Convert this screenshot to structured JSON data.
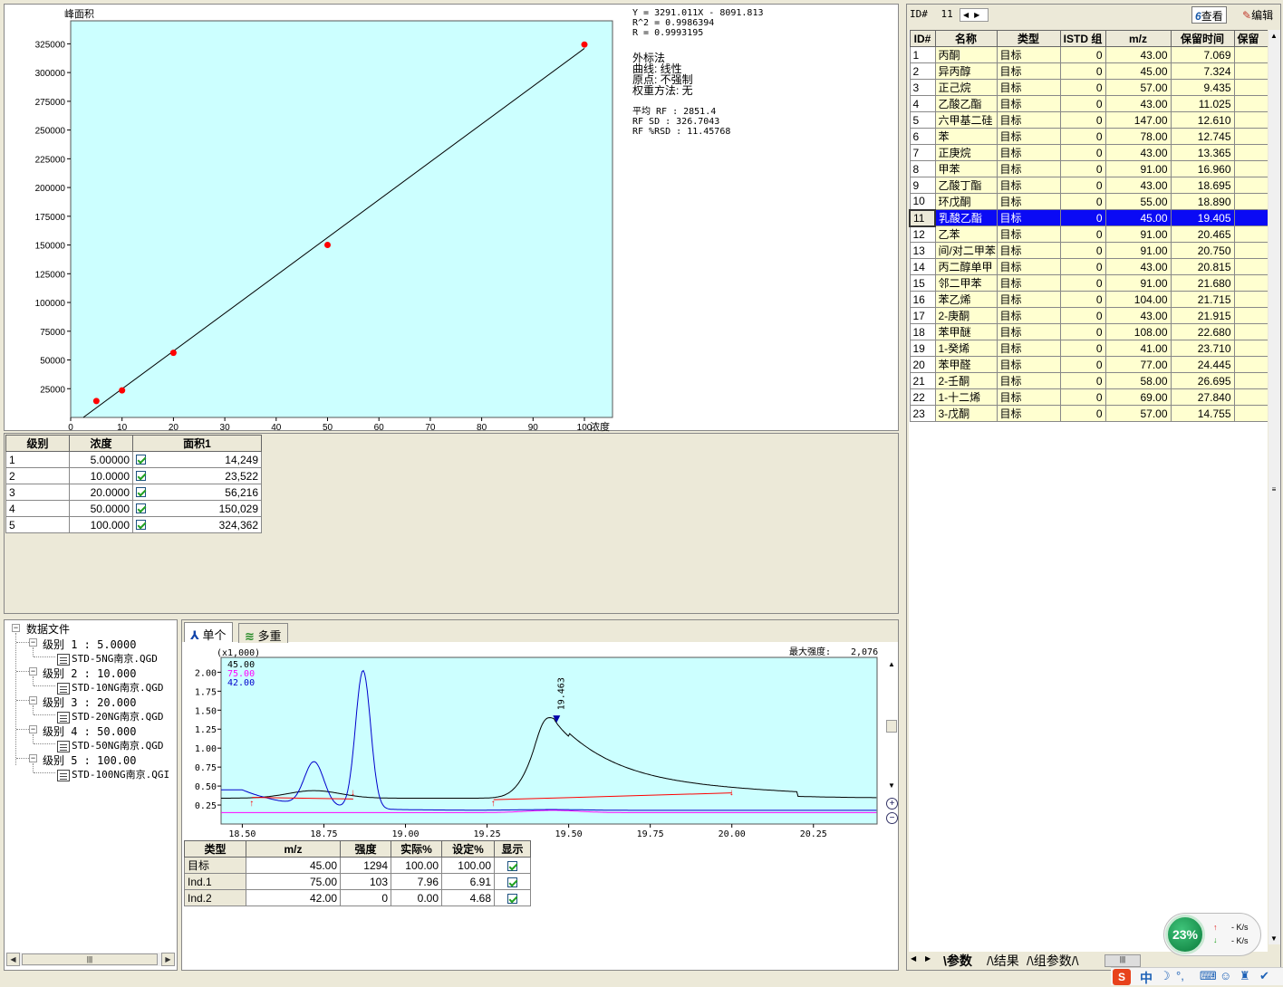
{
  "calib": {
    "y_title": "峰面积",
    "x_title": "浓度",
    "y_ticks": [
      "25000",
      "50000",
      "75000",
      "100000",
      "125000",
      "150000",
      "175000",
      "200000",
      "225000",
      "250000",
      "275000",
      "300000",
      "325000"
    ],
    "x_ticks": [
      "0",
      "10",
      "20",
      "30",
      "40",
      "50",
      "60",
      "70",
      "80",
      "90",
      "100"
    ],
    "equation": "Y = 3291.011X - 8091.813",
    "r2": "R^2 = 0.9986394",
    "r": "R = 0.9993195",
    "method": "外标法",
    "curve": "曲线: 线性",
    "origin": "原点: 不强制",
    "weight": "权重方法: 无",
    "avg_rf": "平均 RF :  2851.4",
    "rf_sd": "RF SD : 326.7043",
    "rf_rsd": "RF %RSD : 11.45768",
    "points": [
      [
        5,
        14249
      ],
      [
        10,
        23522
      ],
      [
        20,
        56216
      ],
      [
        50,
        150029
      ],
      [
        100,
        324362
      ]
    ]
  },
  "level_table": {
    "headers": [
      "级别",
      "浓度",
      "面积1"
    ],
    "rows": [
      [
        "1",
        "5.00000",
        "14,249"
      ],
      [
        "2",
        "10.0000",
        "23,522"
      ],
      [
        "3",
        "20.0000",
        "56,216"
      ],
      [
        "4",
        "50.0000",
        "150,029"
      ],
      [
        "5",
        "100.000",
        "324,362"
      ]
    ]
  },
  "tree": {
    "root": "数据文件",
    "levels": [
      {
        "label": "级别 1 : 5.0000",
        "file": "STD-5NG南京.QGD"
      },
      {
        "label": "级别 2 : 10.000",
        "file": "STD-10NG南京.QGD"
      },
      {
        "label": "级别 3 : 20.000",
        "file": "STD-20NG南京.QGD"
      },
      {
        "label": "级别 4 : 50.000",
        "file": "STD-50NG南京.QGD"
      },
      {
        "label": "级别 5 : 100.00",
        "file": "STD-100NG南京.QGI"
      }
    ]
  },
  "chrom": {
    "tab_single": "单个",
    "tab_multi": "多重",
    "scale": "(x1,000)",
    "max_label": "最大强度:",
    "max_value": "2,076",
    "legend": [
      "45.00",
      "75.00",
      "42.00"
    ],
    "peak_label": "19.463",
    "y_ticks": [
      "0.25",
      "0.50",
      "0.75",
      "1.00",
      "1.25",
      "1.50",
      "1.75",
      "2.00"
    ],
    "x_ticks": [
      "18.50",
      "18.75",
      "19.00",
      "19.25",
      "19.50",
      "19.75",
      "20.00",
      "20.25"
    ]
  },
  "ion_table": {
    "headers": [
      "类型",
      "m/z",
      "强度",
      "实际%",
      "设定%",
      "显示"
    ],
    "rows": [
      [
        "目标",
        "45.00",
        "1294",
        "100.00",
        "100.00"
      ],
      [
        "Ind.1",
        "75.00",
        "103",
        "7.96",
        "6.91"
      ],
      [
        "Ind.2",
        "42.00",
        "0",
        "0.00",
        "4.68"
      ]
    ]
  },
  "compound": {
    "id_label": "ID#",
    "id_value": "11",
    "view_btn": "查看",
    "edit_btn": "编辑",
    "headers": [
      "ID#",
      "名称",
      "类型",
      "ISTD 组",
      "m/z",
      "保留时间",
      "保留"
    ],
    "selected_index": 10,
    "rows": [
      [
        "1",
        "丙酮",
        "目标",
        "0",
        "43.00",
        "7.069"
      ],
      [
        "2",
        "异丙醇",
        "目标",
        "0",
        "45.00",
        "7.324"
      ],
      [
        "3",
        "正己烷",
        "目标",
        "0",
        "57.00",
        "9.435"
      ],
      [
        "4",
        "乙酸乙酯",
        "目标",
        "0",
        "43.00",
        "11.025"
      ],
      [
        "5",
        "六甲基二硅",
        "目标",
        "0",
        "147.00",
        "12.610"
      ],
      [
        "6",
        "苯",
        "目标",
        "0",
        "78.00",
        "12.745"
      ],
      [
        "7",
        "正庚烷",
        "目标",
        "0",
        "43.00",
        "13.365"
      ],
      [
        "8",
        "甲苯",
        "目标",
        "0",
        "91.00",
        "16.960"
      ],
      [
        "9",
        "乙酸丁酯",
        "目标",
        "0",
        "43.00",
        "18.695"
      ],
      [
        "10",
        "环戊酮",
        "目标",
        "0",
        "55.00",
        "18.890"
      ],
      [
        "11",
        "乳酸乙酯",
        "目标",
        "0",
        "45.00",
        "19.405"
      ],
      [
        "12",
        "乙苯",
        "目标",
        "0",
        "91.00",
        "20.465"
      ],
      [
        "13",
        "间/对二甲苯",
        "目标",
        "0",
        "91.00",
        "20.750"
      ],
      [
        "14",
        "丙二醇单甲",
        "目标",
        "0",
        "43.00",
        "20.815"
      ],
      [
        "15",
        "邻二甲苯",
        "目标",
        "0",
        "91.00",
        "21.680"
      ],
      [
        "16",
        "苯乙烯",
        "目标",
        "0",
        "104.00",
        "21.715"
      ],
      [
        "17",
        "2-庚酮",
        "目标",
        "0",
        "43.00",
        "21.915"
      ],
      [
        "18",
        "苯甲醚",
        "目标",
        "0",
        "108.00",
        "22.680"
      ],
      [
        "19",
        "1-癸烯",
        "目标",
        "0",
        "41.00",
        "23.710"
      ],
      [
        "20",
        "苯甲醛",
        "目标",
        "0",
        "77.00",
        "24.445"
      ],
      [
        "21",
        "2-壬酮",
        "目标",
        "0",
        "58.00",
        "26.695"
      ],
      [
        "22",
        "1-十二烯",
        "目标",
        "0",
        "69.00",
        "27.840"
      ],
      [
        "23",
        "3-戊酮",
        "目标",
        "0",
        "57.00",
        "14.755"
      ]
    ],
    "bottom_tabs": [
      "参数",
      "结果",
      "组参数"
    ]
  },
  "net": {
    "percent": "23%",
    "up": "- K/s",
    "down": "- K/s"
  },
  "taskbar": {
    "ime": "中"
  },
  "colors": {
    "plot_bg": "#ccffff",
    "point": "#ff0000",
    "selected": "#0a0af5",
    "row_bg": "#ffffd0",
    "trace_45": "#000000",
    "trace_75": "#ff00ff",
    "trace_42": "#0000cc"
  }
}
